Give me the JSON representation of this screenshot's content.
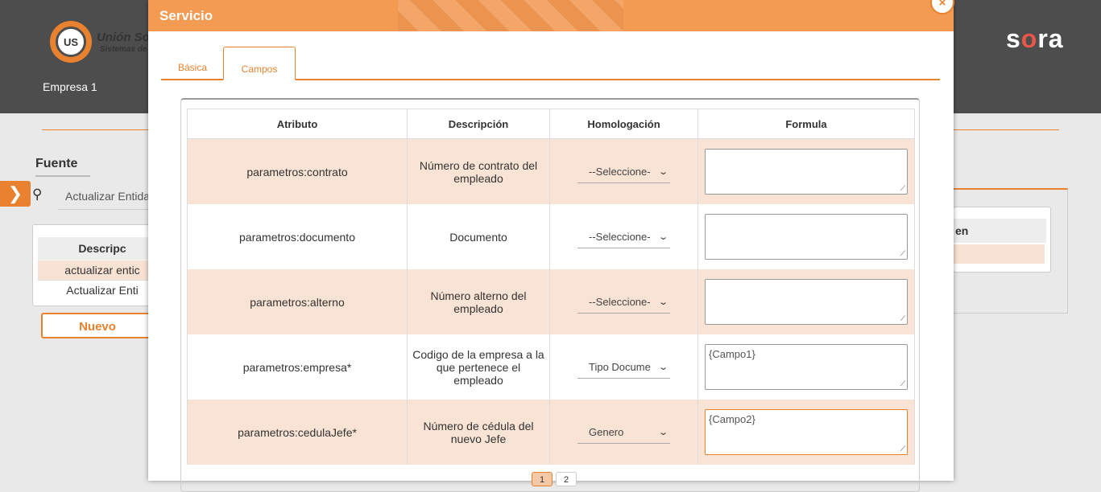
{
  "background": {
    "brand_title": "Unión Sof",
    "brand_subtitle": "Sistemas de",
    "logo_text": "US",
    "company": "Empresa 1",
    "app_logo": "sora",
    "section_title": "Fuente",
    "search_value": "Actualizar Entida",
    "table_header": "Descripc",
    "table_rows": [
      "actualizar entic",
      "Actualizar Enti"
    ],
    "new_button": "Nuevo",
    "right_table_header": "en"
  },
  "modal": {
    "title": "Servicio",
    "close_icon": "×",
    "tabs": [
      {
        "label": "Básica"
      },
      {
        "label": "Campos"
      }
    ],
    "columns": [
      "Atributo",
      "Descripción",
      "Homologación",
      "Formula"
    ],
    "rows": [
      {
        "atributo": "parametros:contrato",
        "descripcion": "Número de contrato del empleado",
        "homologacion": "--Seleccione-",
        "formula": ""
      },
      {
        "atributo": "parametros:documento",
        "descripcion": "Documento",
        "homologacion": "--Seleccione-",
        "formula": ""
      },
      {
        "atributo": "parametros:alterno",
        "descripcion": "Número alterno del empleado",
        "homologacion": "--Seleccione-",
        "formula": ""
      },
      {
        "atributo": "parametros:empresa*",
        "descripcion": "Codigo de la empresa a la que pertenece el empleado",
        "homologacion": "Tipo Docume",
        "formula": "{Campo1}"
      },
      {
        "atributo": "parametros:cedulaJefe*",
        "descripcion": "Número de cédula del nuevo Jefe",
        "homologacion": "Genero",
        "formula": "{Campo2}"
      }
    ],
    "pagination": {
      "pages": [
        "1",
        "2"
      ],
      "current": "1"
    }
  },
  "colors": {
    "accent": "#e8822f",
    "header": "#f39a53",
    "row_highlight": "#f9e3d4"
  }
}
